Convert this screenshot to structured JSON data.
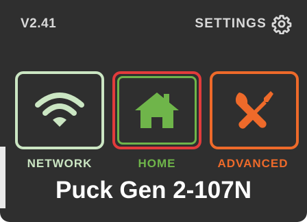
{
  "header": {
    "version": "V2.41",
    "settings_label": "SETTINGS",
    "settings_icon": "gear-icon"
  },
  "tiles": [
    {
      "id": "network",
      "label": "NETWORK",
      "icon": "wifi-icon",
      "color": "#cbe6c3"
    },
    {
      "id": "home",
      "label": "HOME",
      "icon": "house-icon",
      "color": "#6fb54a",
      "selected": true,
      "highlight_color": "#e23b3b"
    },
    {
      "id": "advanced",
      "label": "ADVANCED",
      "icon": "wrench-screwdriver-icon",
      "color": "#ee6a2a"
    }
  ],
  "device_name": "Puck Gen 2-107N",
  "colors": {
    "background": "#2f2f2f",
    "text": "#ffffff",
    "header_text": "#d9d9d9"
  }
}
